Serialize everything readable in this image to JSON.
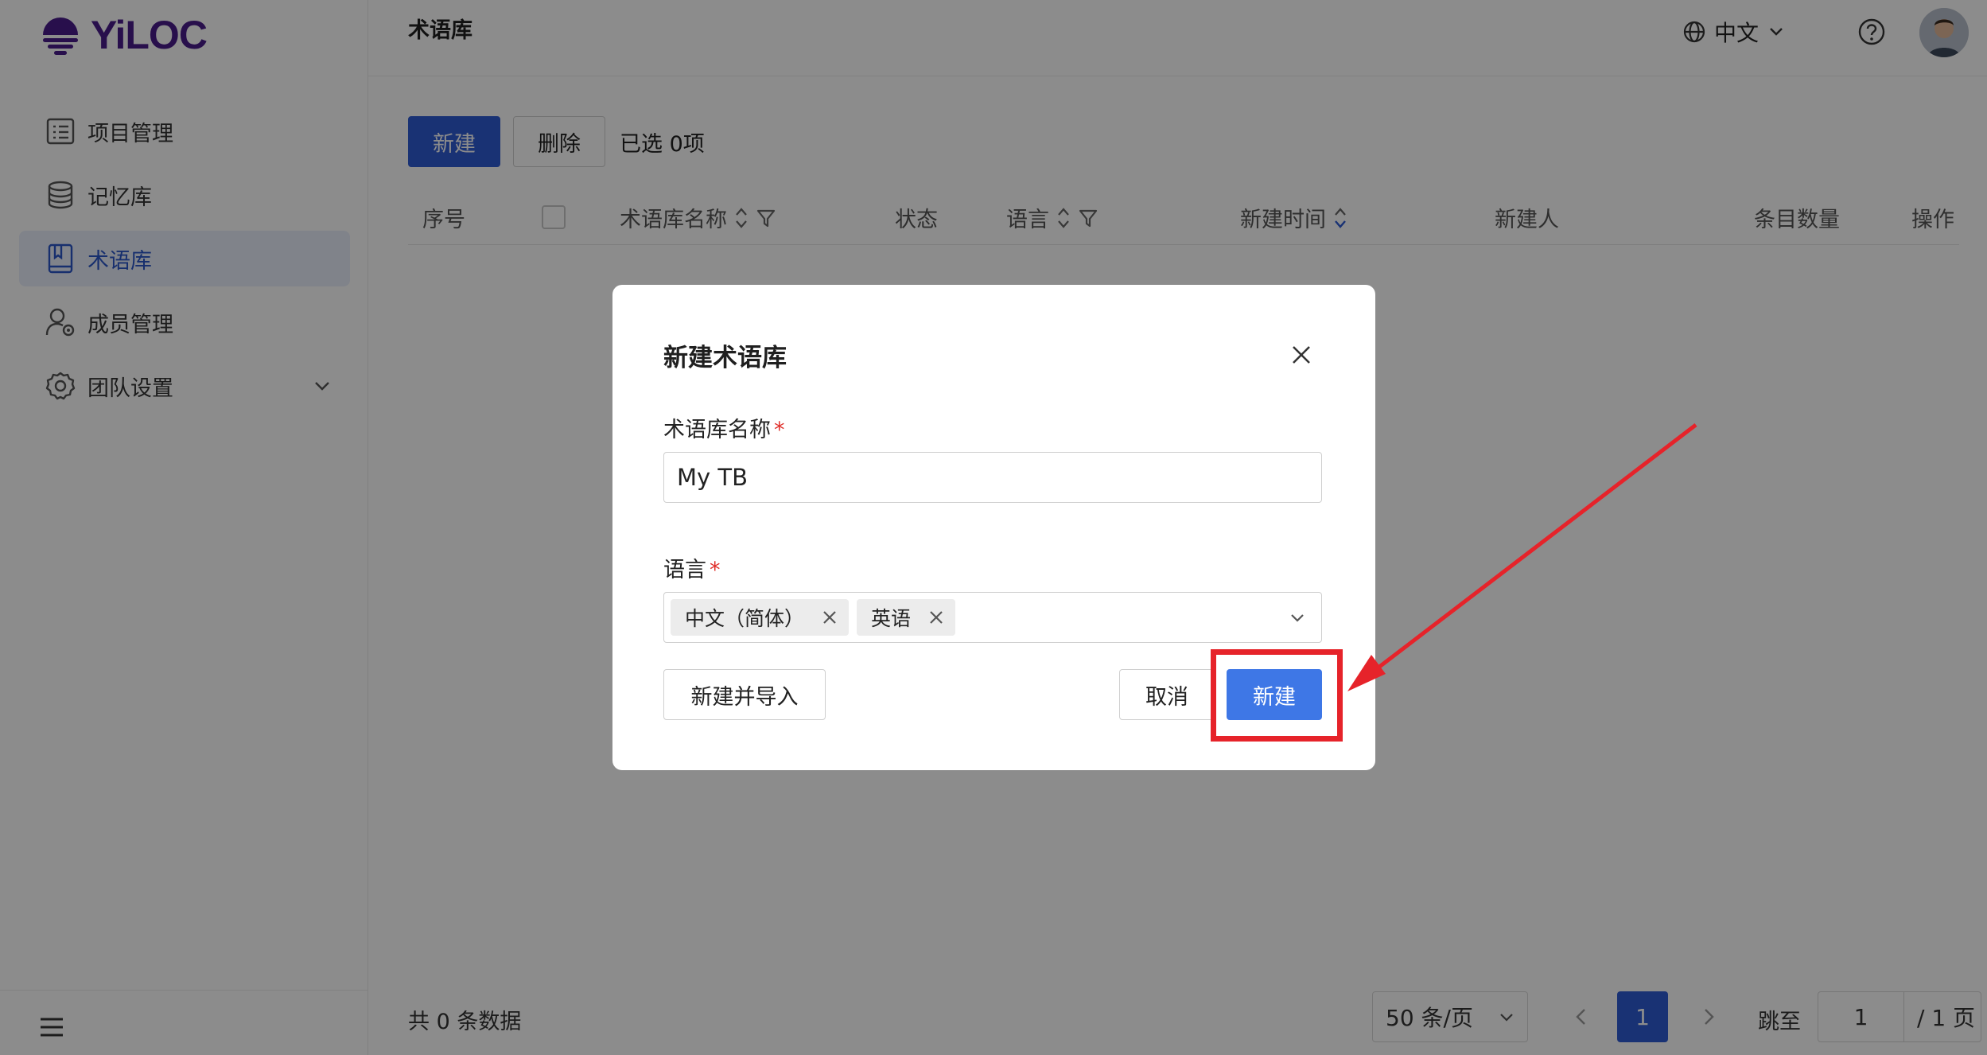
{
  "brand": {
    "name": "YiLOC",
    "color": "#4a1d8a"
  },
  "sidebar": {
    "items": [
      {
        "label": "项目管理",
        "icon": "list-icon"
      },
      {
        "label": "记忆库",
        "icon": "database-icon"
      },
      {
        "label": "术语库",
        "icon": "book-icon",
        "active": true
      },
      {
        "label": "成员管理",
        "icon": "user-settings-icon"
      },
      {
        "label": "团队设置",
        "icon": "gear-icon"
      }
    ]
  },
  "header": {
    "title": "术语库",
    "language": "中文"
  },
  "toolbar": {
    "create_label": "新建",
    "delete_label": "删除",
    "selected_text": "已选 0项"
  },
  "table": {
    "columns": [
      "序号",
      "术语库名称",
      "状态",
      "语言",
      "新建时间",
      "新建人",
      "条目数量",
      "操作"
    ]
  },
  "footer": {
    "total_text": "共 0 条数据",
    "page_size": "50 条/页",
    "current_page": "1",
    "jump_label": "跳至",
    "jump_value": "1",
    "total_pages": "/ 1 页"
  },
  "modal": {
    "title": "新建术语库",
    "name_label": "术语库名称",
    "required_mark": "*",
    "name_value": "My TB",
    "language_label": "语言",
    "language_tags": [
      "中文（简体）",
      "英语"
    ],
    "import_button": "新建并导入",
    "cancel_button": "取消",
    "create_button": "新建"
  },
  "colors": {
    "primary": "#2f5bd3",
    "modal_primary": "#3e77e6",
    "annotation": "#e6232a"
  }
}
